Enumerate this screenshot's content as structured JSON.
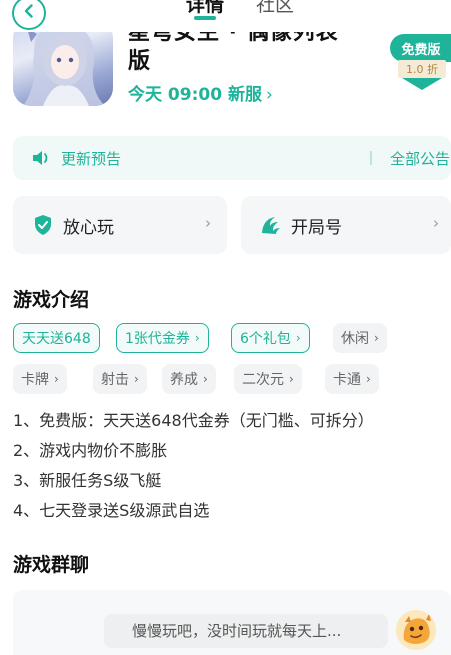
{
  "tabs": [
    {
      "label": "详情",
      "active": true
    },
    {
      "label": "社区",
      "active": false
    }
  ],
  "app": {
    "title_line1": "星穹女主 · 偶像列表",
    "title_line2": "版",
    "server_time": "今天 09:00 新服",
    "server_chevron": "›"
  },
  "badge": {
    "label": "免费版",
    "discount": "1.0 折"
  },
  "notice": {
    "label": "更新预告",
    "all": "全部公告"
  },
  "cards": [
    {
      "label": "放心玩",
      "icon": "shield-check-icon",
      "chevron": "›"
    },
    {
      "label": "开局号",
      "icon": "wave-icon",
      "chevron": "›"
    }
  ],
  "intro": {
    "title": "游戏介绍",
    "tags": [
      {
        "label": "天天送648",
        "style": "green",
        "arrow": ""
      },
      {
        "label": "1张代金券",
        "style": "green",
        "arrow": "›"
      },
      {
        "label": "6个礼包",
        "style": "green",
        "arrow": "›"
      },
      {
        "label": "休闲",
        "style": "gray",
        "arrow": "›"
      },
      {
        "label": "卡牌",
        "style": "gray",
        "arrow": "›"
      },
      {
        "label": "射击",
        "style": "gray",
        "arrow": "›"
      },
      {
        "label": "养成",
        "style": "gray",
        "arrow": "›"
      },
      {
        "label": "二次元",
        "style": "gray",
        "arrow": "›"
      },
      {
        "label": "卡通",
        "style": "gray",
        "arrow": "›"
      }
    ],
    "features": [
      "1、免费版：天天送648代金券（无门槛、可拆分）",
      "2、游戏内物价不膨胀",
      "3、新服任务S级飞艇",
      "4、七天登录送S级源武自选"
    ]
  },
  "chat": {
    "title": "游戏群聊",
    "message": "慢慢玩吧，没时间玩就每天上..."
  },
  "colors": {
    "accent": "#1fb39a",
    "discount_text": "#b4873e"
  }
}
